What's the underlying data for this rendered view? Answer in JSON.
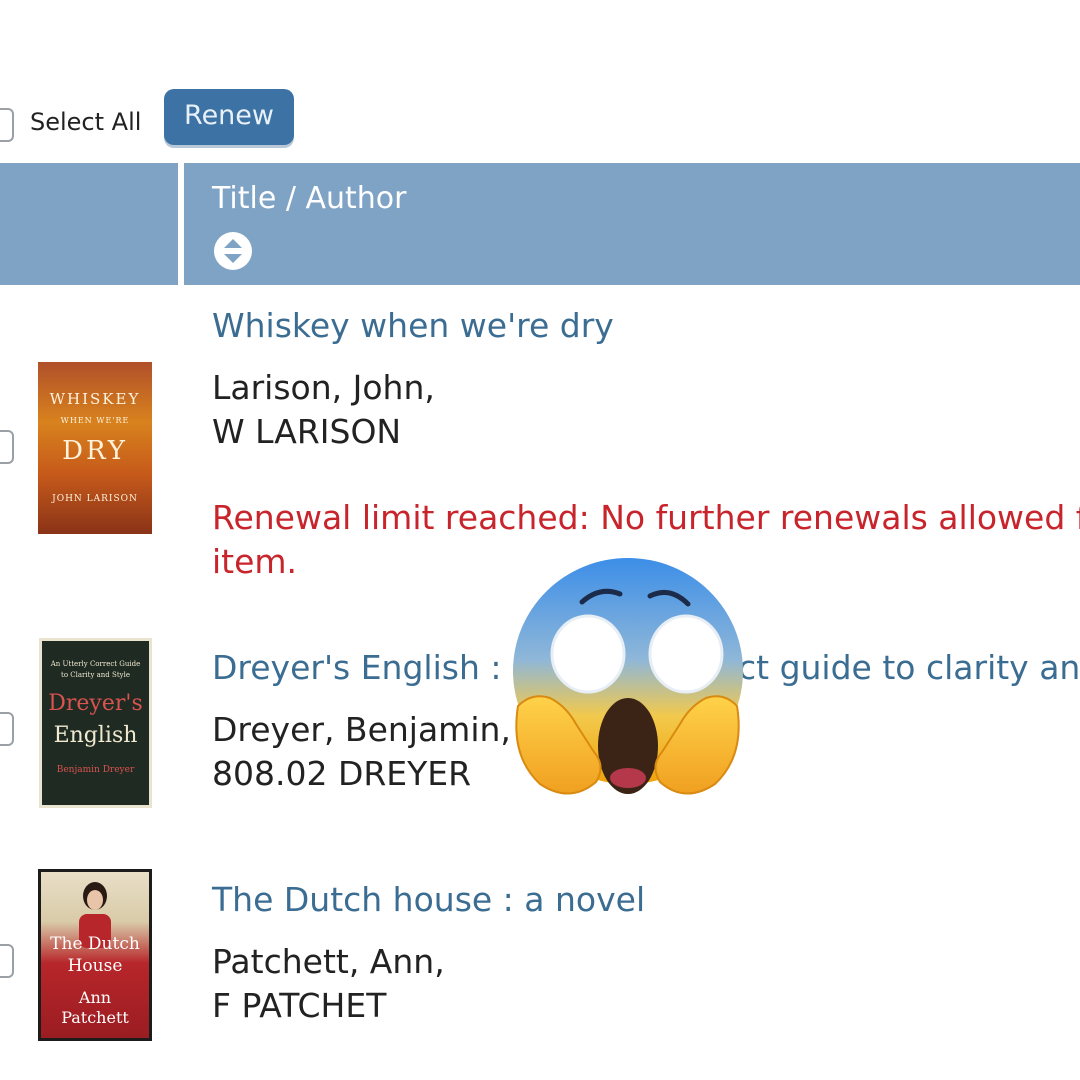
{
  "toolbar": {
    "select_all_label": "Select All",
    "renew_label": "Renew"
  },
  "table": {
    "column_header": "Title / Author"
  },
  "items": [
    {
      "title": "Whiskey when we're dry",
      "author": "Larison, John,",
      "call_number": "W LARISON",
      "message": "Renewal limit reached: No further renewals allowed for this item.",
      "message_line1": "Renewal limit reached: No further renewals allowed fo",
      "message_line2": "item.",
      "cover": {
        "line1": "WHISKEY",
        "line2": "WHEN WE'RE",
        "line3": "DRY",
        "line4": "JOHN LARISON"
      }
    },
    {
      "title_left": "Dreyer's English : ar",
      "title_right": "ct guide to clarity and",
      "author": "Dreyer, Benjamin,",
      "call_number": "808.02 DREYER",
      "cover": {
        "line1": "An Utterly Correct Guide to Clarity and Style",
        "line2": "Dreyer's",
        "line3": "English",
        "line4": "Benjamin Dreyer"
      }
    },
    {
      "title": "The Dutch house : a novel",
      "author": "Patchett, Ann,",
      "call_number": "F PATCHET",
      "cover": {
        "line1": "The Dutch",
        "line2": "House",
        "line3": "Ann",
        "line4": "Patchett"
      }
    }
  ],
  "overlay": {
    "icon": "face-screaming-in-fear-emoji"
  },
  "colors": {
    "header_bg": "#7fa3c4",
    "link": "#3b6d93",
    "error": "#c8242b",
    "button": "#3d72a4"
  }
}
